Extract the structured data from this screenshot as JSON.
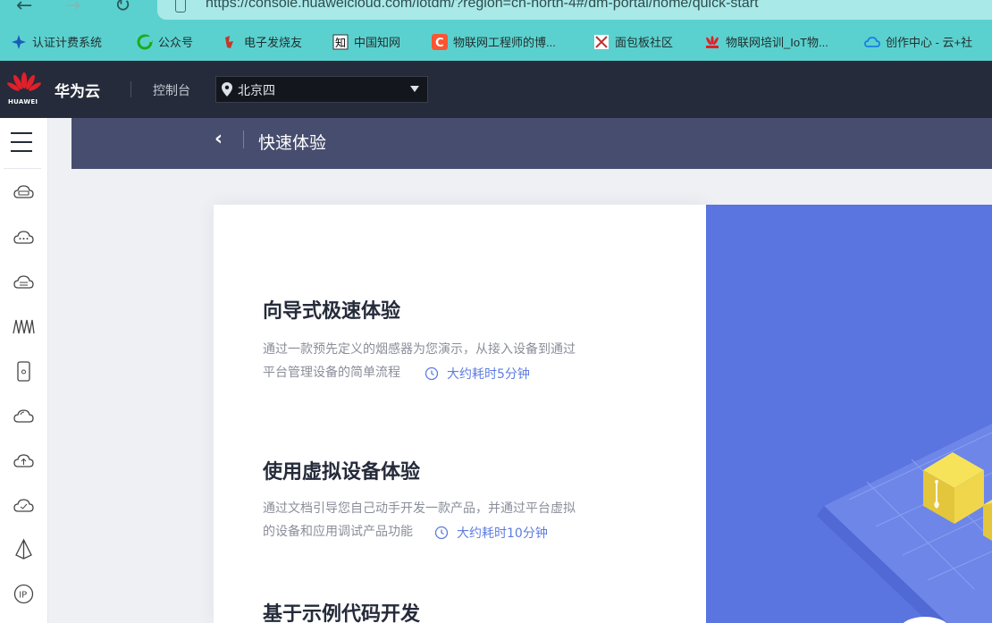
{
  "browser": {
    "url": "https://console.huaweicloud.com/iotdm/?region=cn-north-4#/dm-portal/home/quick-start",
    "bookmarks": [
      {
        "label": "认证计费系统",
        "icon": "gear-bookmark-icon"
      },
      {
        "label": "公众号",
        "icon": "wechat-icon"
      },
      {
        "label": "电子发烧友",
        "icon": "elecfans-icon"
      },
      {
        "label": "中国知网",
        "icon": "cnki-icon"
      },
      {
        "label": "物联网工程师的博...",
        "icon": "csdn-icon"
      },
      {
        "label": "面包板社区",
        "icon": "mianbaoban-icon"
      },
      {
        "label": "物联网培训_IoT物...",
        "icon": "huawei-bookmark-icon"
      },
      {
        "label": "创作中心 - 云+社",
        "icon": "cloud-bookmark-icon"
      }
    ]
  },
  "header": {
    "logo_text": "HUAWEI",
    "brand": "华为云",
    "console_label": "控制台",
    "region": "北京四"
  },
  "page": {
    "title": "快速体验"
  },
  "sections": [
    {
      "title": "向导式极速体验",
      "desc_line1": "通过一款预先定义的烟感器为您演示，从接入设备到通过",
      "desc_line2": "平台管理设备的简单流程",
      "time": "大约耗时5分钟"
    },
    {
      "title": "使用虚拟设备体验",
      "desc_line1": "通过文档引导您自己动手开发一款产品，并通过平台虚拟",
      "desc_line2": "的设备和应用调试产品功能",
      "time": "大约耗时10分钟"
    },
    {
      "title": "基于示例代码开发"
    }
  ],
  "colors": {
    "header_bg": "#252b3a",
    "title_bar_bg": "#474d6e",
    "accent": "#5e7ce0",
    "browser_bg": "#5bd1cf"
  }
}
